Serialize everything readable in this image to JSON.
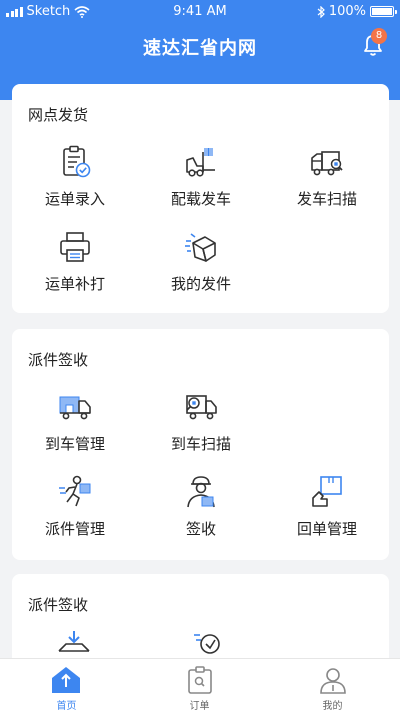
{
  "status_bar": {
    "carrier": "Sketch",
    "time": "9:41 AM",
    "battery": "100%"
  },
  "header": {
    "title": "速达汇省内网",
    "badge_count": "8"
  },
  "sections": [
    {
      "title": "网点发货",
      "items": [
        {
          "label": "运单录入",
          "icon": "waybill-entry-icon"
        },
        {
          "label": "配载发车",
          "icon": "loading-departure-icon"
        },
        {
          "label": "发车扫描",
          "icon": "departure-scan-icon"
        },
        {
          "label": "运单补打",
          "icon": "printer-icon"
        },
        {
          "label": "我的发件",
          "icon": "my-shipments-icon"
        }
      ]
    },
    {
      "title": "派件签收",
      "items": [
        {
          "label": "到车管理",
          "icon": "arrival-management-icon"
        },
        {
          "label": "到车扫描",
          "icon": "arrival-scan-icon"
        },
        {
          "label": "派件管理",
          "icon": "dispatch-management-icon"
        },
        {
          "label": "签收",
          "icon": "sign-receipt-icon"
        },
        {
          "label": "回单管理",
          "icon": "return-receipt-icon"
        }
      ]
    },
    {
      "title": "派件签收"
    }
  ],
  "tabs": [
    {
      "label": "首页",
      "icon": "home-icon",
      "active": true
    },
    {
      "label": "订单",
      "icon": "order-icon",
      "active": false
    },
    {
      "label": "我的",
      "icon": "profile-icon",
      "active": false
    }
  ],
  "colors": {
    "primary": "#3d86f0",
    "badge": "#f37448",
    "icon_stroke": "#333333"
  }
}
